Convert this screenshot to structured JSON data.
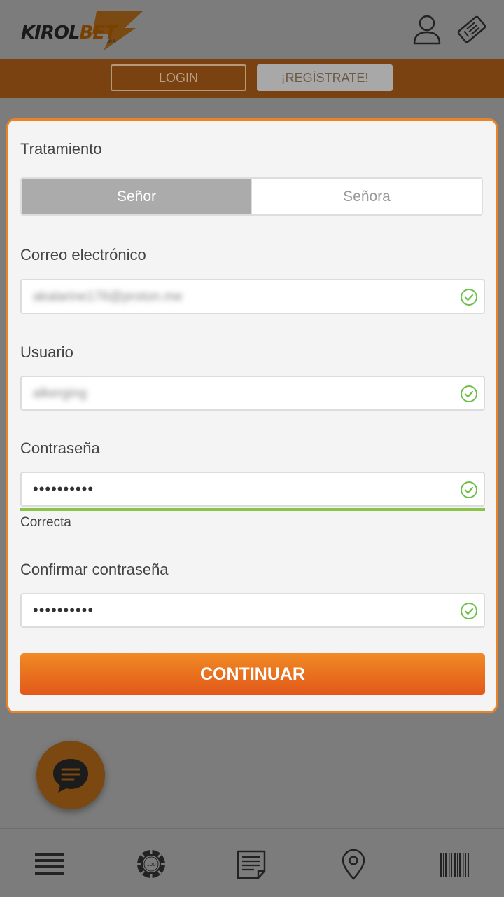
{
  "header": {
    "logo_text_left": "KIROL",
    "logo_text_right": "BET",
    "logo_suffix": ".es",
    "icons": [
      "user-icon",
      "ticket-icon"
    ]
  },
  "auth": {
    "login_label": "LOGIN",
    "register_label": "¡REGÍSTRATE!"
  },
  "form": {
    "treatment_label": "Tratamiento",
    "treatment_options": [
      "Señor",
      "Señora"
    ],
    "treatment_selected": "Señor",
    "email_label": "Correo electrónico",
    "email_value": "akalarine176@proton.me",
    "user_label": "Usuario",
    "user_value": "alkerging",
    "password_label": "Contraseña",
    "password_value": "••••••••••",
    "password_strength_text": "Correcta",
    "confirm_label": "Confirmar contraseña",
    "confirm_value": "••••••••••",
    "continue_label": "CONTINUAR"
  },
  "colors": {
    "accent": "#e98327",
    "valid": "#8bc34a",
    "header_bar": "#7a4211"
  },
  "bottom_nav": {
    "items": [
      "menu-icon",
      "casino-chip-icon",
      "news-icon",
      "location-icon",
      "barcode-icon"
    ]
  }
}
